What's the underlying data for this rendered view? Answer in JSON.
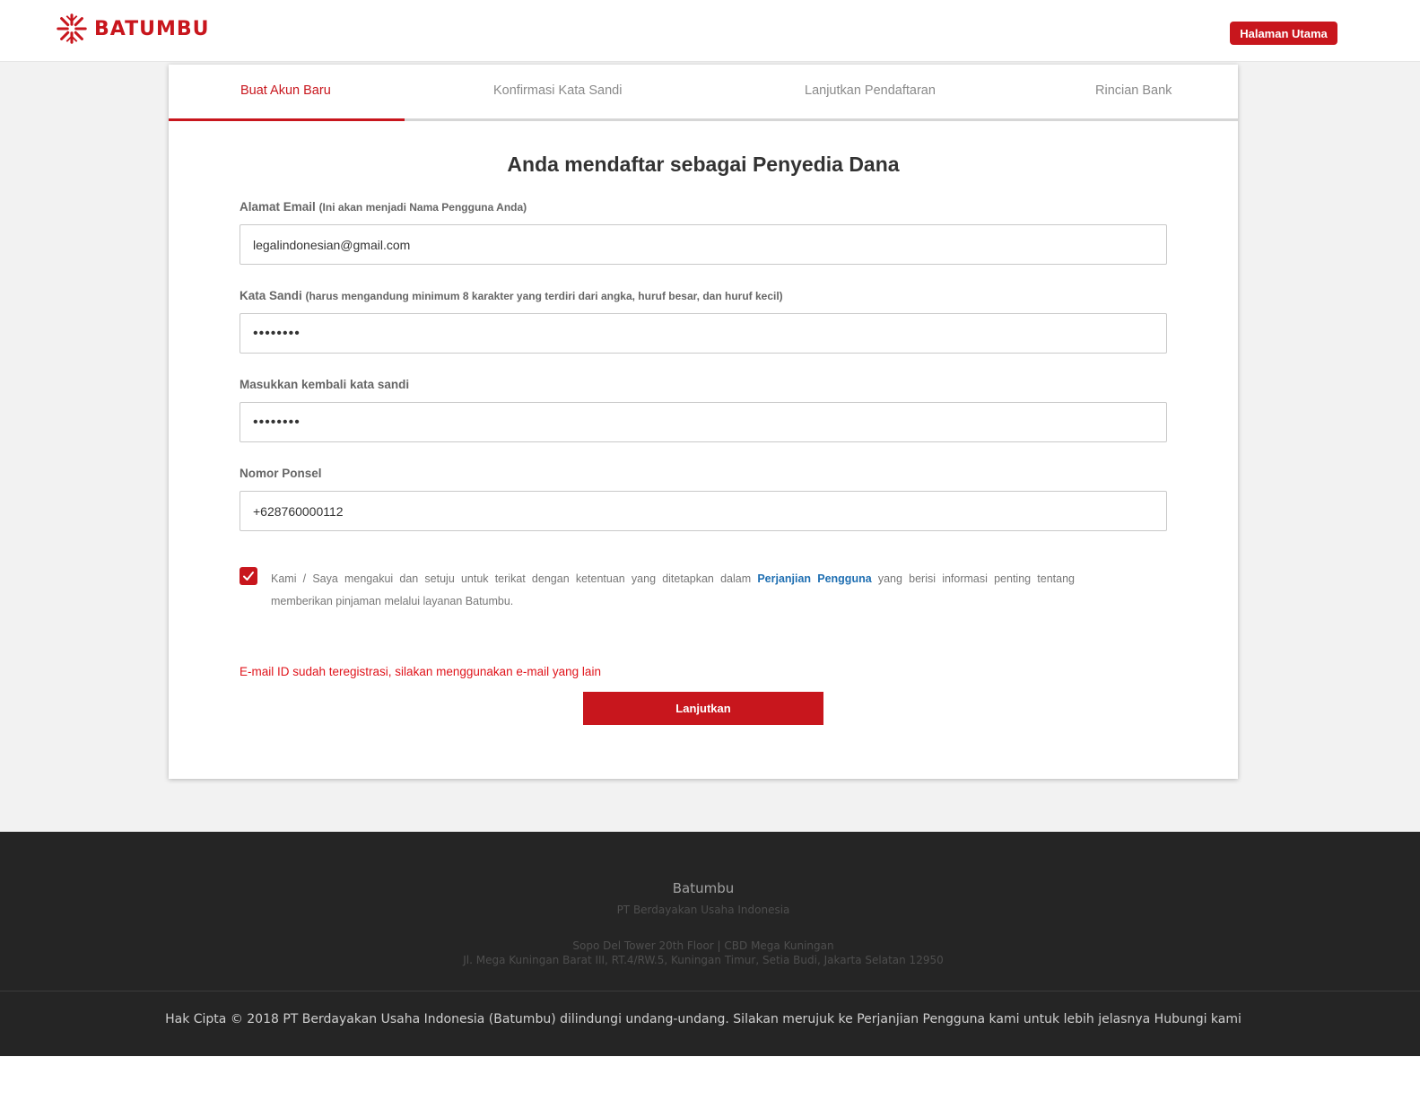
{
  "header": {
    "brand": "BATUMBU",
    "home_button": "Halaman Utama",
    "brand_color": "#c8161d"
  },
  "tabs": [
    {
      "label": "Buat Akun Baru",
      "active": true
    },
    {
      "label": "Konfirmasi Kata Sandi",
      "active": false
    },
    {
      "label": "Lanjutkan Pendaftaran",
      "active": false
    },
    {
      "label": "Rincian Bank",
      "active": false
    }
  ],
  "form": {
    "title": "Anda mendaftar sebagai Penyedia Dana",
    "email": {
      "label": "Alamat Email",
      "note": "(Ini akan menjadi Nama Pengguna Anda)",
      "value": "legalindonesian@gmail.com"
    },
    "password": {
      "label": "Kata Sandi",
      "note": "(harus mengandung minimum 8 karakter yang terdiri dari angka, huruf besar, dan huruf kecil)",
      "value": "••••••••"
    },
    "confirm_password": {
      "label": "Masukkan kembali kata sandi",
      "value": "••••••••"
    },
    "phone": {
      "label": "Nomor Ponsel",
      "value": "+628760000112"
    },
    "agreement": {
      "checked": true,
      "text_before": "Kami / Saya mengakui dan setuju untuk terikat dengan ketentuan yang ditetapkan dalam",
      "link": "Perjanjian Pengguna",
      "text_after": "yang berisi informasi penting tentang memberikan pinjaman melalui layanan Batumbu."
    },
    "error": "E-mail ID sudah teregistrasi, silakan menggunakan e-mail yang lain",
    "submit": "Lanjutkan"
  },
  "footer": {
    "name": "Batumbu",
    "company": "PT Berdayakan Usaha Indonesia",
    "address_line1": "Sopo Del Tower 20th Floor | CBD Mega Kuningan",
    "address_line2": "Jl. Mega Kuningan Barat III, RT.4/RW.5, Kuningan Timur, Setia Budi, Jakarta Selatan 12950",
    "copyright_prefix": "Hak Cipta © 2018 PT Berdayakan Usaha Indonesia (Batumbu) dilindungi undang-undang. Silakan merujuk ke",
    "copyright_link1": "Perjanjian Pengguna",
    "copyright_middle": "kami untuk lebih jelasnya",
    "copyright_link2": "Hubungi kami"
  }
}
